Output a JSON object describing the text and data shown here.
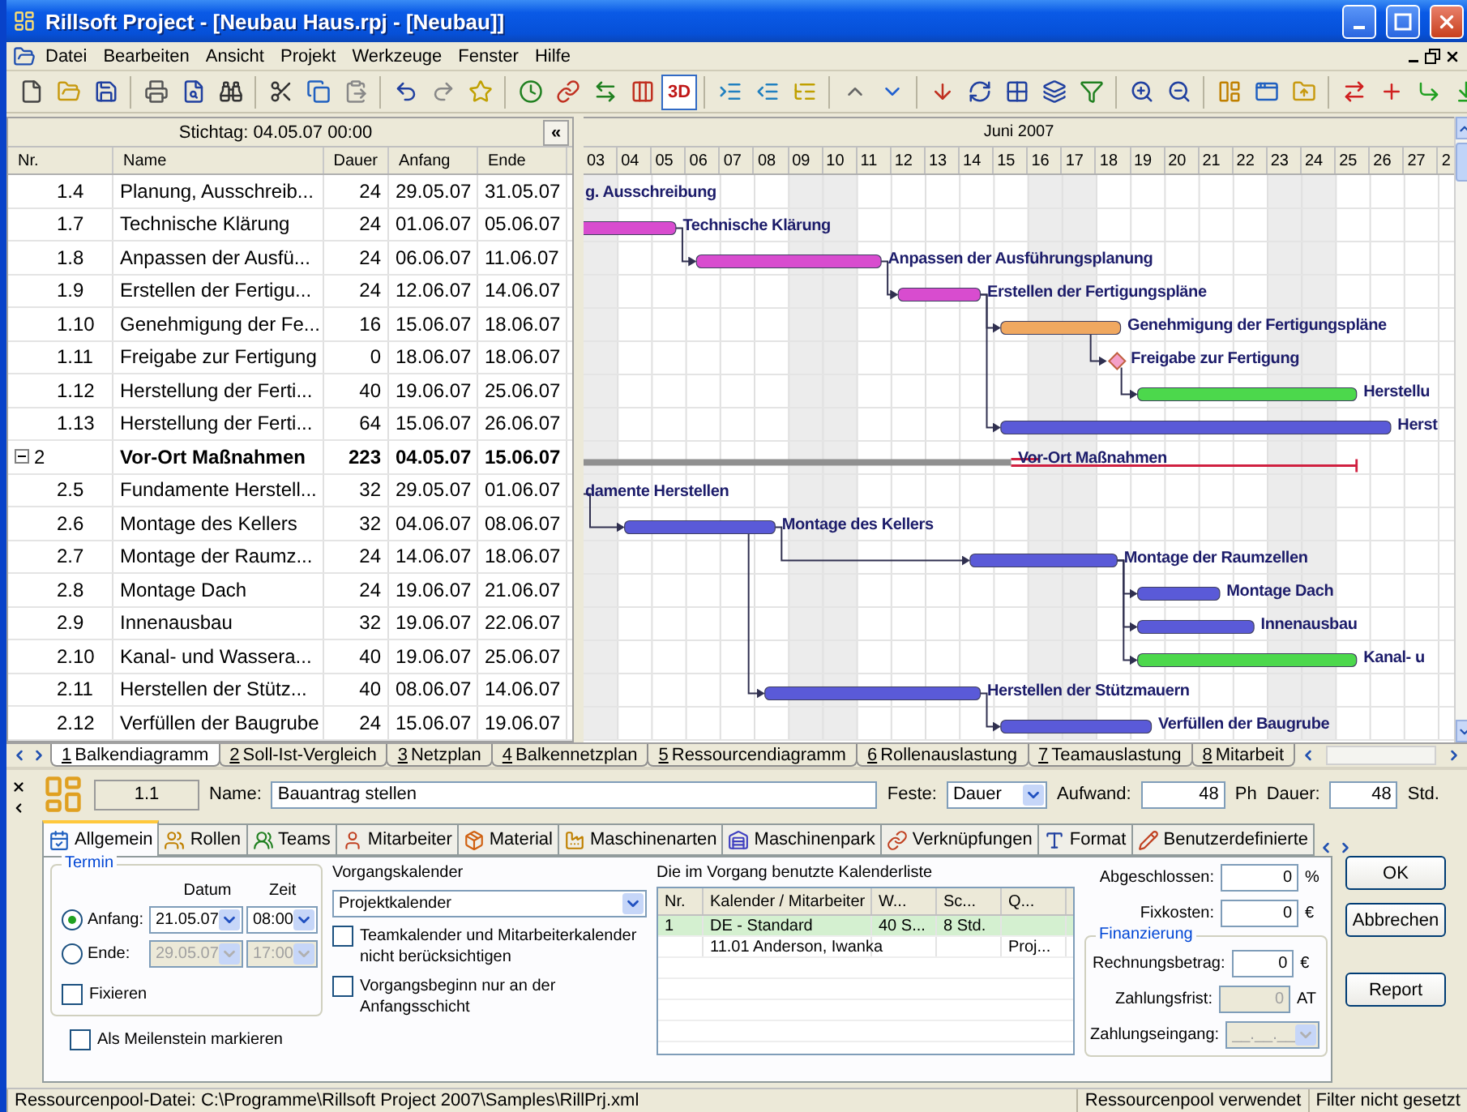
{
  "window": {
    "title": "Rillsoft Project - [Neubau Haus.rpj - [Neubau]]"
  },
  "menu": [
    "Datei",
    "Bearbeiten",
    "Ansicht",
    "Projekt",
    "Werkzeuge",
    "Fenster",
    "Hilfe"
  ],
  "toolbar": {
    "toggle_3d": "3D"
  },
  "table": {
    "stichtag": "Stichtag: 04.05.07 00:00",
    "collapse": "«",
    "columns": [
      "Nr.",
      "Name",
      "Dauer",
      "Anfang",
      "Ende"
    ],
    "rows": [
      {
        "nr": "1.4",
        "name": "Planung, Ausschreib...",
        "dauer": "24",
        "anfang": "29.05.07",
        "ende": "31.05.07",
        "bar_label": "g. Ausschreibung"
      },
      {
        "nr": "1.7",
        "name": "Technische Klärung",
        "dauer": "24",
        "anfang": "01.06.07",
        "ende": "05.06.07",
        "bar_label": "Technische Klärung",
        "color": "#d84ccf"
      },
      {
        "nr": "1.8",
        "name": "Anpassen der Ausfü...",
        "dauer": "24",
        "anfang": "06.06.07",
        "ende": "11.06.07",
        "bar_label": "Anpassen der Ausführungsplanung",
        "color": "#d84ccf"
      },
      {
        "nr": "1.9",
        "name": "Erstellen der Fertigu...",
        "dauer": "24",
        "anfang": "12.06.07",
        "ende": "14.06.07",
        "bar_label": "Erstellen der Fertigungspläne",
        "color": "#d84ccf"
      },
      {
        "nr": "1.10",
        "name": "Genehmigung der Fe...",
        "dauer": "16",
        "anfang": "15.06.07",
        "ende": "18.06.07",
        "bar_label": "Genehmigung der Fertigungspläne",
        "color": "#f0a860"
      },
      {
        "nr": "1.11",
        "name": "Freigabe zur Fertigung",
        "dauer": "0",
        "anfang": "18.06.07",
        "ende": "18.06.07",
        "bar_label": "Freigabe zur Fertigung",
        "color": "#f4a0c8"
      },
      {
        "nr": "1.12",
        "name": "Herstellung der Ferti...",
        "dauer": "40",
        "anfang": "19.06.07",
        "ende": "25.06.07",
        "bar_label": "Herstellu",
        "color": "#4cd84c"
      },
      {
        "nr": "1.13",
        "name": "Herstellung der Ferti...",
        "dauer": "64",
        "anfang": "15.06.07",
        "ende": "26.06.07",
        "bar_label": "Herst",
        "color": "#5a5ad8"
      },
      {
        "nr": "2",
        "name": "Vor-Ort Maßnahmen",
        "dauer": "223",
        "anfang": "04.05.07",
        "ende": "15.06.07",
        "bar_label": "Vor-Ort Maßnahmen",
        "kind": "summary",
        "expanded": true,
        "children": [
          {
            "nr": "2.5",
            "name": "Fundamente Herstell...",
            "dauer": "32",
            "anfang": "29.05.07",
            "ende": "01.06.07",
            "bar_label": "damente Herstellen"
          },
          {
            "nr": "2.6",
            "name": "Montage des Kellers",
            "dauer": "32",
            "anfang": "04.06.07",
            "ende": "08.06.07",
            "bar_label": "Montage des Kellers",
            "color": "#5a5ad8"
          },
          {
            "nr": "2.7",
            "name": "Montage der Raumz...",
            "dauer": "24",
            "anfang": "14.06.07",
            "ende": "18.06.07",
            "bar_label": "Montage der Raumzellen",
            "color": "#5a5ad8"
          },
          {
            "nr": "2.8",
            "name": "Montage Dach",
            "dauer": "24",
            "anfang": "19.06.07",
            "ende": "21.06.07",
            "bar_label": "Montage Dach",
            "color": "#5a5ad8"
          },
          {
            "nr": "2.9",
            "name": "Innenausbau",
            "dauer": "32",
            "anfang": "19.06.07",
            "ende": "22.06.07",
            "bar_label": "Innenausbau",
            "color": "#5a5ad8"
          },
          {
            "nr": "2.10",
            "name": "Kanal- und Wassera...",
            "dauer": "40",
            "anfang": "19.06.07",
            "ende": "25.06.07",
            "bar_label": "Kanal- u",
            "color": "#4cd84c"
          },
          {
            "nr": "2.11",
            "name": "Herstellen der Stütz...",
            "dauer": "40",
            "anfang": "08.06.07",
            "ende": "14.06.07",
            "bar_label": "Herstellen der Stützmauern",
            "color": "#5a5ad8"
          },
          {
            "nr": "2.12",
            "name": "Verfüllen der Baugrube",
            "dauer": "24",
            "anfang": "15.06.07",
            "ende": "19.06.07",
            "bar_label": "Verfüllen der Baugrube",
            "color": "#5a5ad8"
          }
        ]
      }
    ]
  },
  "gantt": {
    "month": "Juni 2007",
    "days": [
      "03",
      "04",
      "05",
      "06",
      "07",
      "08",
      "09",
      "10",
      "11",
      "12",
      "13",
      "14",
      "15",
      "16",
      "17",
      "18",
      "19",
      "20",
      "21",
      "22",
      "23",
      "24",
      "25",
      "26",
      "27",
      "2"
    ]
  },
  "view_tabs": [
    {
      "number": "1",
      "label": "Balkendiagramm",
      "selected": true
    },
    {
      "number": "2",
      "label": "Soll-Ist-Vergleich",
      "selected": false
    },
    {
      "number": "3",
      "label": "Netzplan",
      "selected": false
    },
    {
      "number": "4",
      "label": "Balkennetzplan",
      "selected": false
    },
    {
      "number": "5",
      "label": "Ressourcendiagramm",
      "selected": false
    },
    {
      "number": "6",
      "label": "Rollenauslastung",
      "selected": false
    },
    {
      "number": "7",
      "label": "Teamauslastung",
      "selected": false
    },
    {
      "number": "8",
      "label": "Mitarbeit",
      "selected": false
    }
  ],
  "detail": {
    "nr": "1.1",
    "name_label": "Name:",
    "name": "Bauantrag stellen",
    "fixed_label": "Feste:",
    "fixed": "Dauer",
    "effort_label": "Aufwand:",
    "effort": "48",
    "effort_unit": "Ph",
    "duration_label": "Dauer:",
    "duration": "48",
    "duration_unit": "Std.",
    "tabs": [
      {
        "label": "Allgemein",
        "selected": true
      },
      {
        "label": "Rollen",
        "selected": false
      },
      {
        "label": "Teams",
        "selected": false
      },
      {
        "label": "Mitarbeiter",
        "selected": false
      },
      {
        "label": "Material",
        "selected": false
      },
      {
        "label": "Maschinenarten",
        "selected": false
      },
      {
        "label": "Maschinenpark",
        "selected": false
      },
      {
        "label": "Verknüpfungen",
        "selected": false
      },
      {
        "label": "Format",
        "selected": false
      },
      {
        "label": "Benutzerdefinierte",
        "selected": false
      }
    ],
    "termin": {
      "title": "Termin",
      "date_header": "Datum",
      "time_header": "Zeit",
      "options": [
        {
          "label": "Anfang:",
          "selected": true,
          "date": "21.05.07",
          "time": "08:00",
          "disabled": false
        },
        {
          "label": "Ende:",
          "selected": false,
          "date": "29.05.07",
          "time": "17:00",
          "disabled": true
        }
      ],
      "fix": {
        "label": "Fixieren",
        "checked": false
      }
    },
    "milestone": {
      "label": "Als Meilenstein markieren",
      "checked": false
    },
    "calendar": {
      "title": "Vorgangskalender",
      "value": "Projektkalender",
      "options": [
        {
          "label": "Teamkalender und Mitarbeiterkalender nicht berücksichtigen",
          "checked": false
        },
        {
          "label": "Vorgangsbeginn nur an der Anfangsschicht",
          "checked": false
        }
      ]
    },
    "calendar_list": {
      "title": "Die im Vorgang benutzte Kalenderliste",
      "columns": [
        "Nr.",
        "Kalender / Mitarbeiter",
        "W...",
        "Sc...",
        "Q..."
      ],
      "rows": [
        {
          "cells": [
            "1",
            "DE - Standard",
            "40 S...",
            "8 Std.",
            ""
          ],
          "selected": true
        },
        {
          "cells": [
            "",
            "11.01 Anderson, Iwanka",
            "",
            "",
            "Proj..."
          ],
          "selected": false
        }
      ]
    },
    "done": {
      "label": "Abgeschlossen:",
      "value": "0",
      "unit": "%"
    },
    "fixed_costs": {
      "label": "Fixkosten:",
      "value": "0",
      "unit": "€"
    },
    "finance": {
      "title": "Finanzierung",
      "invoice": {
        "label": "Rechnungsbetrag:",
        "value": "0",
        "unit": "€"
      },
      "term": {
        "label": "Zahlungsfrist:",
        "value": "0",
        "unit": "AT",
        "disabled": true
      },
      "receipt": {
        "label": "Zahlungseingang:",
        "value": "__.__.__",
        "disabled": true
      }
    },
    "buttons": [
      "OK",
      "Abbrechen",
      "Report"
    ]
  },
  "status_bar": [
    "Ressourcenpool-Datei: C:\\Programme\\Rillsoft Project 2007\\Samples\\RillPrj.xml",
    "Ressourcenpool verwendet",
    "Filter nicht gesetzt"
  ]
}
